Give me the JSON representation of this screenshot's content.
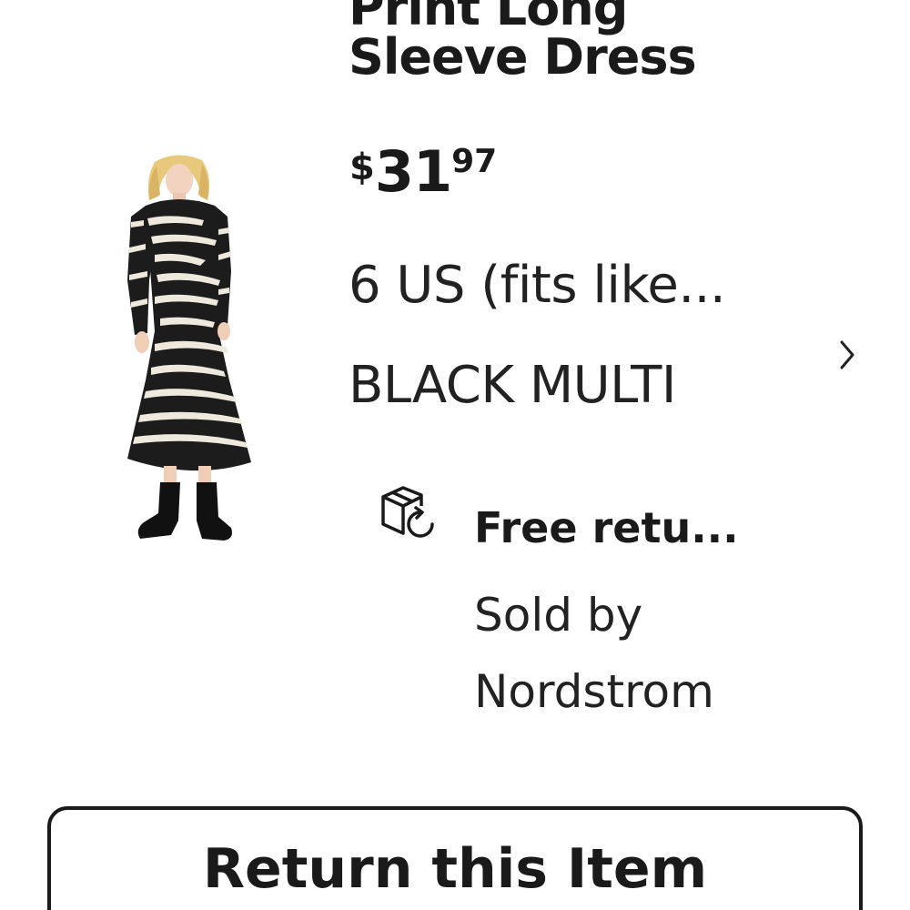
{
  "product": {
    "title_line1": "Print Long",
    "title_line2": "Sleeve Dress",
    "image_icon": "zebra-print-dress-photo",
    "price": {
      "currency": "$",
      "dollars": "31",
      "cents": "97"
    },
    "variant": {
      "size": "6 US (fits like...",
      "color": "BLACK MULTI",
      "chevron_icon": "chevron-right-icon"
    }
  },
  "returns": {
    "icon": "box-return-icon",
    "title": "Free retu...",
    "sold_by": "Sold by Nordstrom"
  },
  "actions": {
    "return_label": "Return this Item"
  },
  "colors": {
    "text": "#1a1a1a",
    "border": "#1a1a1a",
    "background": "#ffffff"
  }
}
